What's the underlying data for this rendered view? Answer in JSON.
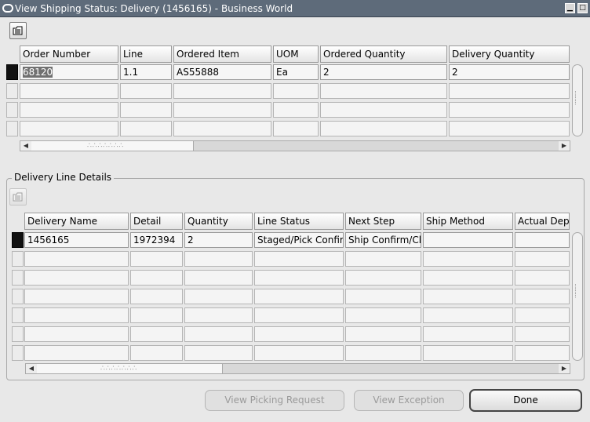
{
  "window": {
    "title": "View Shipping Status: Delivery (1456165) - Business World",
    "minimize_glyph": "▁",
    "maximize_glyph": "□"
  },
  "icons": {
    "folder": "folder-icon"
  },
  "top_table": {
    "columns": [
      "Order Number",
      "Line",
      "Ordered Item",
      "UOM",
      "Ordered Quantity",
      "Delivery Quantity"
    ],
    "rows": [
      [
        "68120",
        "1.1",
        "AS55888",
        "Ea",
        "2",
        "2"
      ]
    ],
    "empty_rows": 3
  },
  "details": {
    "section_title": "Delivery Line Details",
    "columns": [
      "Delivery Name",
      "Detail",
      "Quantity",
      "Line Status",
      "Next Step",
      "Ship Method",
      "Actual Departure Date"
    ],
    "rows": [
      [
        "1456165",
        "1972394",
        "2",
        "Staged/Pick Confirmed",
        "Ship Confirm/Close Trip Stop",
        "",
        ""
      ]
    ],
    "empty_rows": 6
  },
  "buttons": {
    "view_picking_request": "View Picking Request",
    "view_exception": "View Exception",
    "done": "Done"
  },
  "colors": {
    "titlebar": "#5e6b7a",
    "background": "#e8e8e8"
  }
}
